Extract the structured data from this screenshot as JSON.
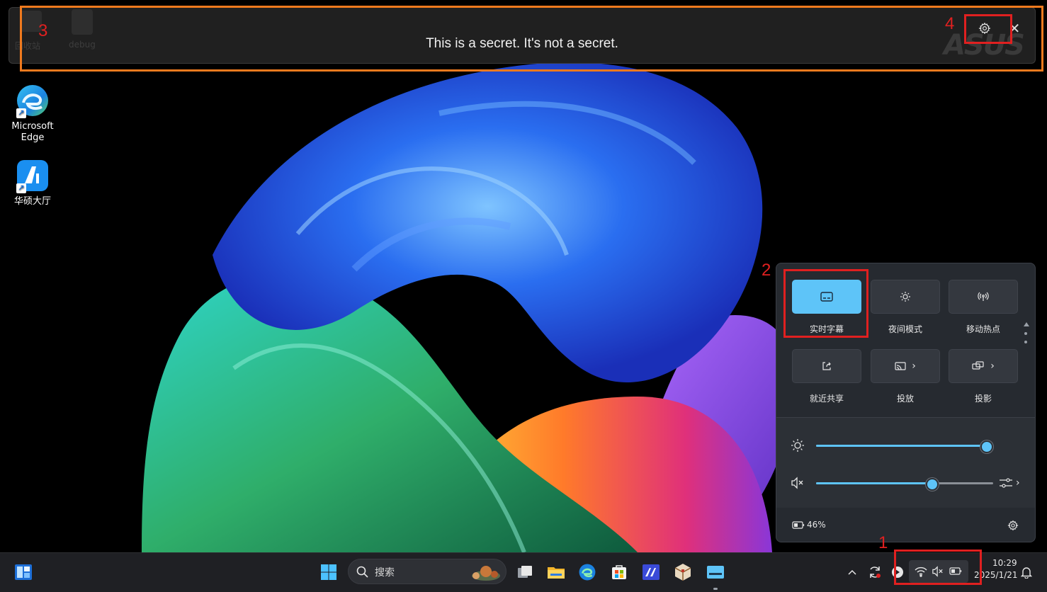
{
  "caption": {
    "text": "This  is a secret.  It's not a secret.",
    "ghost_recycle": "回收站",
    "ghost_debug": "debug",
    "ghost_logo": "ASUS"
  },
  "desktop": {
    "icons": [
      {
        "label_line1": "Microsoft",
        "label_line2": "Edge"
      },
      {
        "label_line1": "华硕大厅",
        "label_line2": ""
      }
    ]
  },
  "annotations": {
    "labels": [
      "1",
      "2",
      "3",
      "4"
    ],
    "color_red": "#e02020",
    "color_orange": "#f07a1e"
  },
  "quick_settings": {
    "tiles": [
      {
        "label": "实时字幕",
        "icon": "live-captions-icon",
        "active": true
      },
      {
        "label": "夜间模式",
        "icon": "night-light-icon",
        "active": false
      },
      {
        "label": "移动热点",
        "icon": "hotspot-icon",
        "active": false
      },
      {
        "label": "就近共享",
        "icon": "nearby-share-icon",
        "active": false
      },
      {
        "label": "投放",
        "icon": "cast-icon",
        "active": false
      },
      {
        "label": "投影",
        "icon": "project-icon",
        "active": false
      }
    ],
    "brightness_pct": 96,
    "volume_pct": 65,
    "battery": "46%",
    "accent_color": "#5ec4f8"
  },
  "taskbar": {
    "search_label": "搜索",
    "clock_time": "10:29",
    "clock_date": "2025/1/21"
  }
}
